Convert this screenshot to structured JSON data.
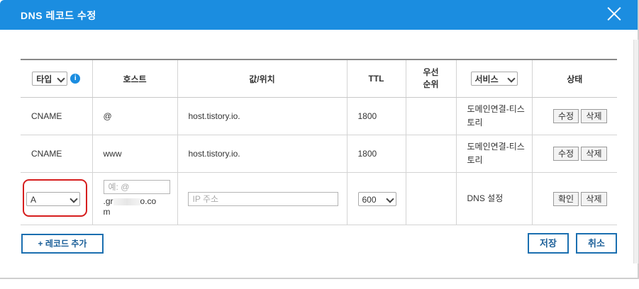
{
  "dialog": {
    "title": "DNS 레코드 수정"
  },
  "table": {
    "headers": {
      "type_select": "타입",
      "host": "호스트",
      "value": "값/위치",
      "ttl": "TTL",
      "priority": "우선\n순위",
      "service_select": "서비스",
      "status": "상태"
    },
    "rows": [
      {
        "type": "CNAME",
        "host": "@",
        "value": "host.tistory.io.",
        "ttl": "1800",
        "priority": "",
        "service": "도메인연결-티스토리",
        "edit": "수정",
        "delete": "삭제"
      },
      {
        "type": "CNAME",
        "host": "www",
        "value": "host.tistory.io.",
        "ttl": "1800",
        "priority": "",
        "service": "도메인연결-티스토리",
        "edit": "수정",
        "delete": "삭제"
      }
    ],
    "new_row": {
      "type_value": "A",
      "host_placeholder": "예: @",
      "host_suffix_start": ".gr",
      "host_suffix_end": "o.co",
      "host_suffix_wrap": "m",
      "value_placeholder": "IP 주소",
      "ttl_value": "600",
      "service": "DNS 설정",
      "confirm": "확인",
      "delete": "삭제"
    }
  },
  "footer": {
    "add_record": "+ 레코드 추가",
    "save": "저장",
    "cancel": "취소"
  },
  "colors": {
    "titlebar": "#1b8de0",
    "button_border": "#1b6fb0",
    "highlight": "#d61e1e"
  }
}
